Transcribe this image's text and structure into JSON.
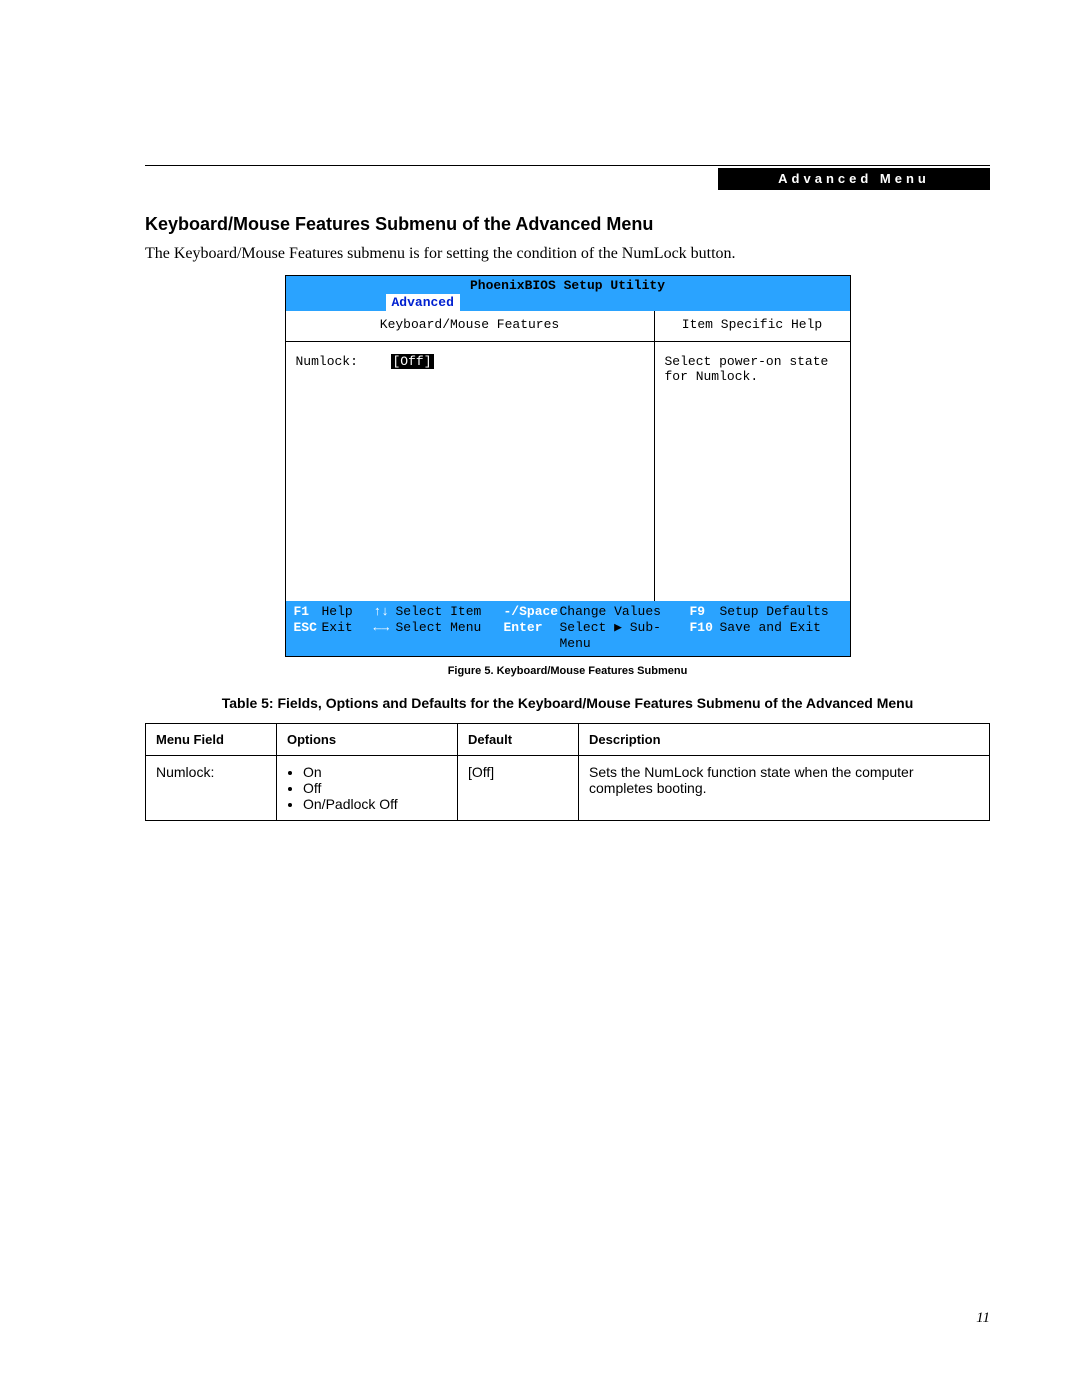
{
  "header": {
    "bar_text": "Advanced Menu"
  },
  "section": {
    "title": "Keyboard/Mouse Features Submenu of the Advanced Menu",
    "intro": "The Keyboard/Mouse Features submenu is for setting the condition of the NumLock button."
  },
  "bios": {
    "title": "PhoenixBIOS Setup Utility",
    "active_tab": "Advanced",
    "main_header": "Keyboard/Mouse Features",
    "help_header": "Item Specific Help",
    "field_label": "Numlock:",
    "field_value": "[Off]",
    "help_text1": "Select power-on state",
    "help_text2": "for Numlock.",
    "footer": {
      "r1": {
        "k1": "F1",
        "l1": "Help",
        "k2": "↑↓",
        "l2": "Select Item",
        "k3": "-/Space",
        "l3": "Change Values",
        "k4": "F9",
        "l4": "Setup Defaults"
      },
      "r2": {
        "k1": "ESC",
        "l1": "Exit",
        "k2": "←→",
        "l2": "Select Menu",
        "k3": "Enter",
        "l3": "Select ▶ Sub-Menu",
        "k4": "F10",
        "l4": "Save and Exit"
      }
    }
  },
  "figure_caption": "Figure 5.  Keyboard/Mouse Features Submenu",
  "table_caption": "Table 5: Fields, Options and Defaults for the Keyboard/Mouse Features Submenu of the Advanced Menu",
  "table": {
    "headers": {
      "menu": "Menu Field",
      "options": "Options",
      "def": "Default",
      "desc": "Description"
    },
    "row": {
      "menu": "Numlock:",
      "opt1": "On",
      "opt2": "Off",
      "opt3": "On/Padlock Off",
      "def": "[Off]",
      "desc": "Sets the NumLock function state when the computer completes booting."
    }
  },
  "page_number": "11"
}
